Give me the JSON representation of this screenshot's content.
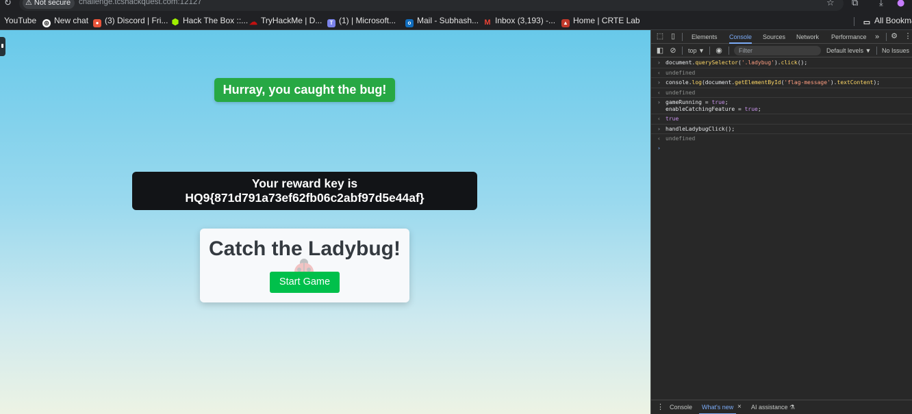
{
  "browser": {
    "security_badge": "⚠ Not secure",
    "url": "challenge.tcshackquest.com:12127",
    "bookmarks": [
      {
        "label": "YouTube",
        "icon": "youtube-icon",
        "color": "#202124"
      },
      {
        "label": "New chat",
        "icon": "chatgpt-icon",
        "color": "#ffffff"
      },
      {
        "label": "(3) Discord | Fri...",
        "icon": "discord-icon",
        "color": "#e8543a"
      },
      {
        "label": "Hack The Box ::...",
        "icon": "htb-icon",
        "color": "#9fef00"
      },
      {
        "label": "TryHackMe | D...",
        "icon": "tryhackme-icon",
        "color": "#c11111"
      },
      {
        "label": "(1) | Microsoft...",
        "icon": "teams-icon",
        "color": "#7b83eb"
      },
      {
        "label": "Mail - Subhash...",
        "icon": "outlook-icon",
        "color": "#0f6cbd"
      },
      {
        "label": "Inbox (3,193) -...",
        "icon": "gmail-icon",
        "color": "#ea4335"
      },
      {
        "label": "Home | CRTE Lab",
        "icon": "crte-icon",
        "color": "#c0392b"
      }
    ],
    "all_bookmarks": "All Bookma"
  },
  "game": {
    "success_message": "Hurray, you caught the bug!",
    "reward_line1": "Your reward key is",
    "reward_key": "HQ9{871d791a73ef62fb06c2abf97d5e44af}",
    "title": "Catch the Ladybug!",
    "start_button": "Start Game"
  },
  "devtools": {
    "tabs": [
      "Elements",
      "Console",
      "Sources",
      "Network",
      "Performance"
    ],
    "active_tab": "Console",
    "more_tabs": "»",
    "context": "top ▼",
    "filter_placeholder": "Filter",
    "levels": "Default levels ▼",
    "issues": "No Issues",
    "console_lines": [
      {
        "kind": "in",
        "text": "document.querySelector('.ladybug').click();"
      },
      {
        "kind": "out",
        "text": "undefined"
      },
      {
        "kind": "in",
        "text": "console.log(document.getElementById('flag-message').textContent);"
      },
      {
        "kind": "out",
        "text": "undefined"
      },
      {
        "kind": "in",
        "text": "gameRunning = true;\nenableCatchingFeature = true;"
      },
      {
        "kind": "out-true",
        "text": "true"
      },
      {
        "kind": "in",
        "text": "handleLadybugClick();"
      },
      {
        "kind": "out",
        "text": "undefined"
      }
    ],
    "drawer_tabs": [
      "Console",
      "What's new",
      "AI assistance"
    ],
    "drawer_active": "What's new",
    "drawer_close": "×"
  }
}
